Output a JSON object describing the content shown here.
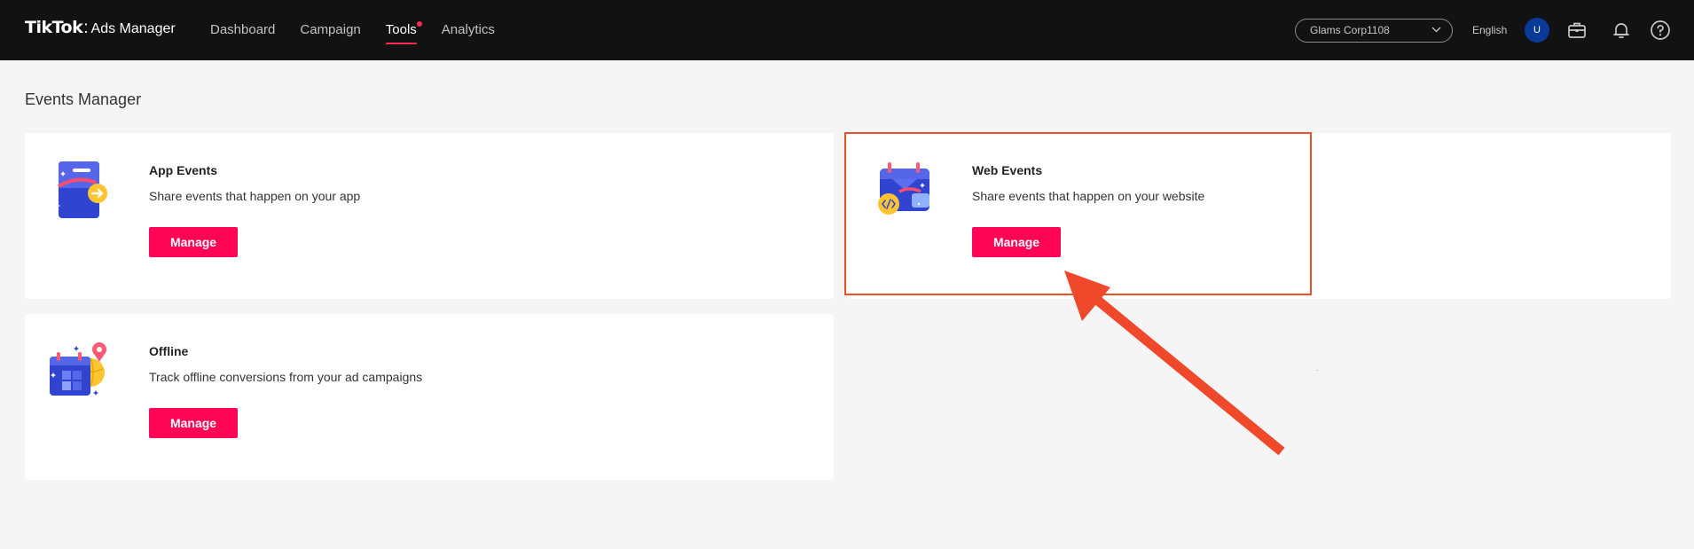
{
  "header": {
    "brand": "TikTok",
    "separator": ":",
    "product": "Ads Manager",
    "nav": [
      {
        "label": "Dashboard",
        "active": false
      },
      {
        "label": "Campaign",
        "active": false
      },
      {
        "label": "Tools",
        "active": true,
        "has_dot": true
      },
      {
        "label": "Analytics",
        "active": false
      }
    ],
    "account": "Glams Corp1108",
    "language": "English",
    "avatar_initial": "U",
    "icons": [
      "briefcase-icon",
      "bell-icon",
      "help-icon"
    ]
  },
  "page": {
    "title": "Events Manager"
  },
  "cards": [
    {
      "id": "app",
      "title": "App Events",
      "description": "Share events that happen on your app",
      "button": "Manage",
      "icon": "app-events-icon"
    },
    {
      "id": "web",
      "title": "Web Events",
      "description": "Share events that happen on your website",
      "button": "Manage",
      "icon": "web-events-icon",
      "highlighted": true
    },
    {
      "id": "offline",
      "title": "Offline",
      "description": "Track offline conversions from your ad campaigns",
      "button": "Manage",
      "icon": "offline-events-icon"
    }
  ],
  "colors": {
    "topbar": "#121212",
    "brand_pink": "#fe0655",
    "annotation_red": "#e8502e",
    "page_bg": "#f5f5f5"
  }
}
